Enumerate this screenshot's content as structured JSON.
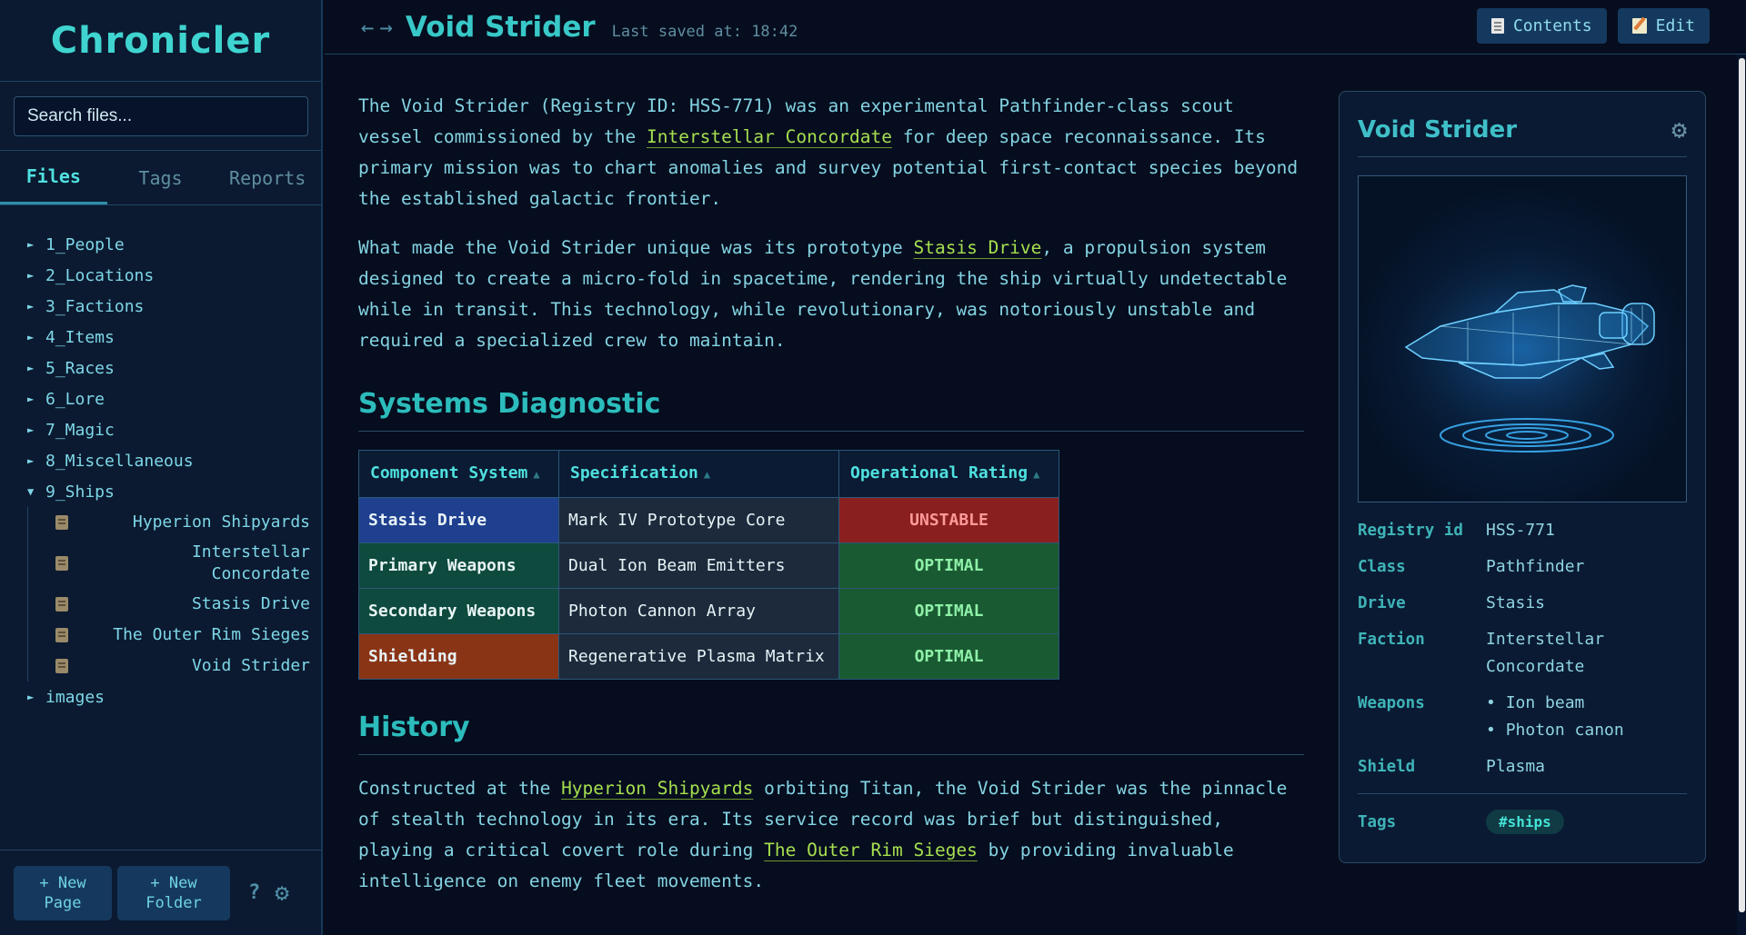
{
  "app": {
    "name": "Chronicler"
  },
  "sidebar": {
    "search_placeholder": "Search files...",
    "tabs": [
      "Files",
      "Tags",
      "Reports"
    ],
    "folders": [
      "1_People",
      "2_Locations",
      "3_Factions",
      "4_Items",
      "5_Races",
      "6_Lore",
      "7_Magic",
      "8_Miscellaneous",
      "9_Ships"
    ],
    "ships_files": [
      "Hyperion Shipyards",
      "Interstellar Concordate",
      "Stasis Drive",
      "The Outer Rim Sieges",
      "Void Strider"
    ],
    "images_folder": "images",
    "footer": {
      "new_page": "+ New Page",
      "new_folder": "+ New Folder",
      "help": "?"
    }
  },
  "header": {
    "back": "←",
    "forward": "→",
    "title": "Void Strider",
    "saved": "Last saved at: 18:42",
    "contents_label": "Contents",
    "edit_label": "Edit"
  },
  "content": {
    "p1": [
      "The Void Strider (Registry ID: HSS-771) was an experimental Pathfinder-class scout vessel commissioned by the ",
      "Interstellar Concordate",
      " for deep space reconnaissance. Its primary mission was to chart anomalies and survey potential first-contact species beyond the established galactic frontier."
    ],
    "p2": [
      "What made the Void Strider unique was its prototype ",
      "Stasis Drive",
      ", a propulsion system designed to create a micro-fold in spacetime, rendering the ship virtually undetectable while in transit. This technology, while revolutionary, was notoriously unstable and required a specialized crew to maintain."
    ],
    "systems_heading": "Systems Diagnostic",
    "table": {
      "headers": [
        "Component System",
        "Specification",
        "Operational Rating"
      ],
      "rows": [
        [
          "Stasis Drive",
          "Mark IV Prototype Core",
          "UNSTABLE"
        ],
        [
          "Primary Weapons",
          "Dual Ion Beam Emitters",
          "OPTIMAL"
        ],
        [
          "Secondary Weapons",
          "Photon Cannon Array",
          "OPTIMAL"
        ],
        [
          "Shielding",
          "Regenerative Plasma Matrix",
          "OPTIMAL"
        ]
      ],
      "component_colors": [
        "#1f3f8f",
        "#0e4a3e",
        "#0e4a3e",
        "#8a3416"
      ],
      "rating_colors": [
        "#8a1f1f",
        "#1a5a32",
        "#1a5a32",
        "#1a5a32"
      ],
      "rating_text_colors": [
        "#ff9a9a",
        "#8ef0a8",
        "#8ef0a8",
        "#8ef0a8"
      ]
    },
    "history_heading": "History",
    "p3": [
      "Constructed at the ",
      "Hyperion Shipyards",
      " orbiting Titan, the Void Strider was the pinnacle of stealth technology in its era. Its service record was brief but distinguished, playing a critical covert role during ",
      "The Outer Rim Sieges",
      " by providing invaluable intelligence on enemy fleet movements."
    ]
  },
  "infobox": {
    "title": "Void Strider",
    "fields": {
      "registry_key": "Registry id",
      "registry_val": "HSS-771",
      "class_key": "Class",
      "class_val": "Pathfinder",
      "drive_key": "Drive",
      "drive_val": "Stasis",
      "faction_key": "Faction",
      "faction_val": "Interstellar Concordate",
      "weapons_key": "Weapons",
      "weapons_vals": [
        "Ion beam",
        "Photon canon"
      ],
      "shield_key": "Shield",
      "shield_val": "Plasma",
      "tags_key": "Tags",
      "tag": "#ships"
    }
  }
}
